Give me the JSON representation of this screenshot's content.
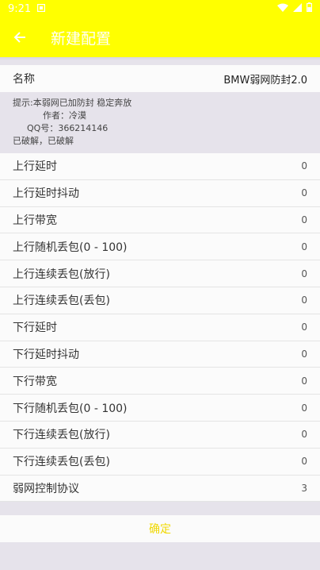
{
  "status_bar": {
    "time": "9:21"
  },
  "toolbar": {
    "title": "新建配置"
  },
  "name_row": {
    "label": "名称",
    "value": "BMW弱网防封2.0"
  },
  "info": {
    "line1": "提示:本弱网已加防封 稳定奔放",
    "line2": "作者：冷漠",
    "line3": "QQ号：366214146",
    "line4": "已破解，已破解"
  },
  "settings": [
    {
      "label": "上行延时",
      "value": "0"
    },
    {
      "label": "上行延时抖动",
      "value": "0"
    },
    {
      "label": "上行带宽",
      "value": "0"
    },
    {
      "label": "上行随机丢包(0 - 100)",
      "value": "0"
    },
    {
      "label": "上行连续丢包(放行)",
      "value": "0"
    },
    {
      "label": "上行连续丢包(丢包)",
      "value": "0"
    },
    {
      "label": "下行延时",
      "value": "0"
    },
    {
      "label": "下行延时抖动",
      "value": "0"
    },
    {
      "label": "下行带宽",
      "value": "0"
    },
    {
      "label": "下行随机丢包(0 - 100)",
      "value": "0"
    },
    {
      "label": "下行连续丢包(放行)",
      "value": "0"
    },
    {
      "label": "下行连续丢包(丢包)",
      "value": "0"
    },
    {
      "label": "弱网控制协议",
      "value": "3"
    }
  ],
  "confirm_label": "确定",
  "colors": {
    "accent": "#ffff00",
    "confirm_text": "#f0d800",
    "background": "#e6e3eb"
  }
}
